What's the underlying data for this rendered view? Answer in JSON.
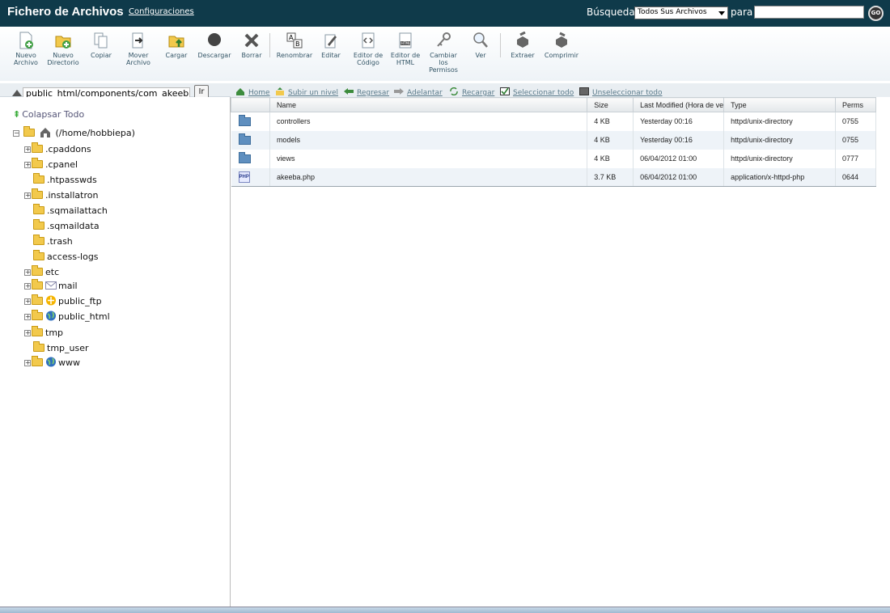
{
  "header": {
    "title": "Fichero de Archivos",
    "settings_link": "Configuraciones",
    "search_label": "Búsqueda",
    "search_scope": "Todos Sus Archivos",
    "para_label": "para",
    "search_value": "",
    "go_label": "GO"
  },
  "toolbar": {
    "new_file": "Nuevo Archivo",
    "new_dir": "Nuevo Directorio",
    "copy": "Copiar",
    "move": "Mover Archivo",
    "upload": "Cargar",
    "download": "Descargar",
    "delete": "Borrar",
    "rename": "Renombrar",
    "edit": "Editar",
    "code_editor": "Editor de Código",
    "html_editor": "Editor de HTML",
    "permissions": "Cambiar los Permisos",
    "view": "Ver",
    "extract": "Extraer",
    "compress": "Comprimir"
  },
  "pathbar": {
    "path": "public_html/components/com_akeeba",
    "go_label": "Ir"
  },
  "nav": {
    "home": "Home",
    "up_level": "Subir un nivel",
    "back": "Regresar",
    "forward": "Adelantar",
    "reload": "Recargar",
    "select_all": "Seleccionar todo",
    "unselect_all": "Unseleccionar todo"
  },
  "tree": {
    "collapse_all": "Colapsar Todo",
    "root": "(/home/hobbiepa)",
    "items": [
      ".cpaddons",
      ".cpanel",
      ".htpasswds",
      ".installatron",
      ".sqmailattach",
      ".sqmaildata",
      ".trash",
      "access-logs",
      "etc",
      "mail",
      "public_ftp",
      "public_html",
      "tmp",
      "tmp_user",
      "www"
    ]
  },
  "table": {
    "headers": {
      "name": "Name",
      "size": "Size",
      "modified": "Last Modified (Hora de ve",
      "type": "Type",
      "perms": "Perms"
    },
    "rows": [
      {
        "name": "controllers",
        "size": "4 KB",
        "modified": "Yesterday 00:16",
        "type": "httpd/unix-directory",
        "perms": "0755"
      },
      {
        "name": "models",
        "size": "4 KB",
        "modified": "Yesterday 00:16",
        "type": "httpd/unix-directory",
        "perms": "0755"
      },
      {
        "name": "views",
        "size": "4 KB",
        "modified": "06/04/2012 01:00",
        "type": "httpd/unix-directory",
        "perms": "0777"
      },
      {
        "name": "akeeba.php",
        "size": "3.7 KB",
        "modified": "06/04/2012 01:00",
        "type": "application/x-httpd-php",
        "perms": "0644"
      }
    ],
    "php_icon_label": "PHP"
  },
  "colors": {
    "topbar": "#0f3a4a",
    "row_alt": "#eef3f8",
    "folder": "#f2c94c",
    "dir_icon": "#5f8fbf"
  }
}
